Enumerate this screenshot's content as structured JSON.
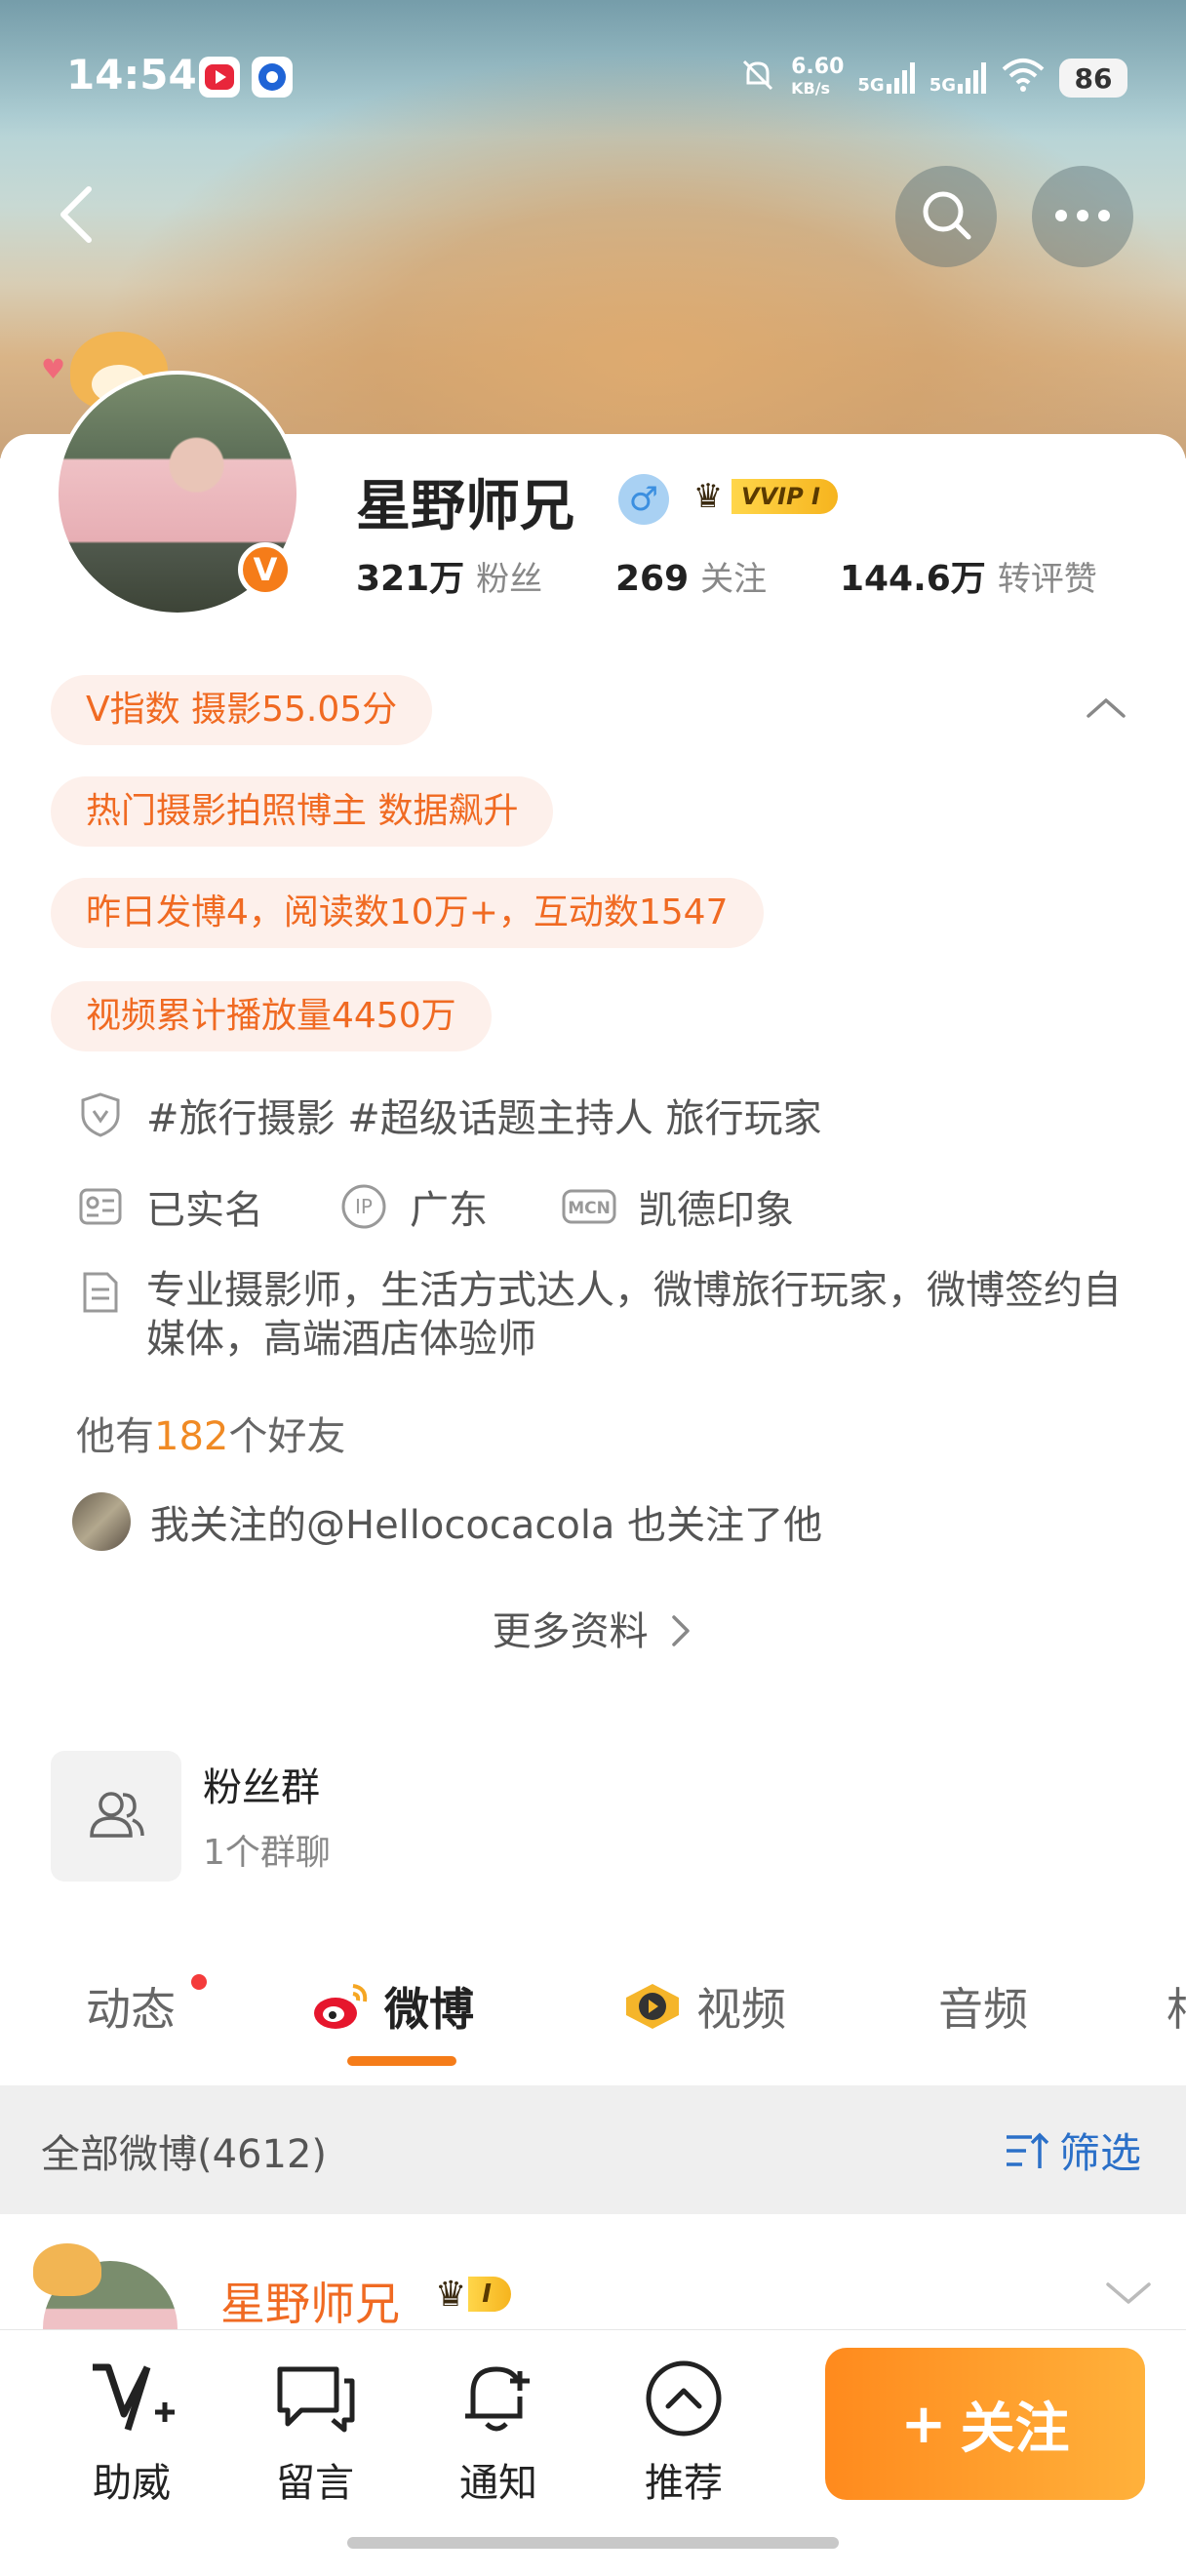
{
  "status_bar": {
    "time": "14:54",
    "net_speed_top": "6.60",
    "net_speed_unit": "KB/s",
    "signal1": "5G",
    "signal2": "5G",
    "battery": "86"
  },
  "profile": {
    "name": "星野师兄",
    "gender_symbol": "♂",
    "vip_label": "VVIP I",
    "verified_badge": "V",
    "stats": [
      {
        "value": "321万",
        "label": "粉丝"
      },
      {
        "value": "269",
        "label": "关注"
      },
      {
        "value": "144.6万",
        "label": "转评赞"
      }
    ]
  },
  "highlights": [
    "V指数 摄影55.05分",
    "热门摄影拍照博主 数据飙升",
    "昨日发博4，阅读数10万+，互动数1547",
    "视频累计播放量4450万"
  ],
  "info": {
    "tags": "#旅行摄影 #超级话题主持人 旅行玩家",
    "real_name": "已实名",
    "ip_label": "IP",
    "ip": "广东",
    "mcn_label": "MCN",
    "mcn": "凯德印象",
    "bio": "专业摄影师，生活方式达人，微博旅行玩家，微博签约自媒体，高端酒店体验师"
  },
  "friends": {
    "prefix": "他有",
    "count": "182",
    "suffix": "个好友"
  },
  "mutual": "我关注的@Hellococacola 也关注了他",
  "more_info": "更多资料",
  "fan_group": {
    "title": "粉丝群",
    "subtitle": "1个群聊"
  },
  "tabs": [
    {
      "label": "动态"
    },
    {
      "label": "微博"
    },
    {
      "label": "视频"
    },
    {
      "label": "音频"
    },
    {
      "label": "相"
    }
  ],
  "filter": {
    "all_label": "全部微博(4612)",
    "filter_label": "筛选"
  },
  "post": {
    "author": "星野师兄",
    "vip_label": "I"
  },
  "bottom_nav": [
    {
      "label": "助威",
      "icon": "boost-icon"
    },
    {
      "label": "留言",
      "icon": "message-icon"
    },
    {
      "label": "通知",
      "icon": "bell-add-icon"
    },
    {
      "label": "推荐",
      "icon": "recommend-icon"
    }
  ],
  "follow_button": {
    "plus": "+",
    "label": "关注"
  },
  "colors": {
    "accent_orange": "#f57c19",
    "highlight_bg": "#fdf0eb",
    "highlight_text": "#f06a22",
    "link_blue": "#2b70c8"
  }
}
